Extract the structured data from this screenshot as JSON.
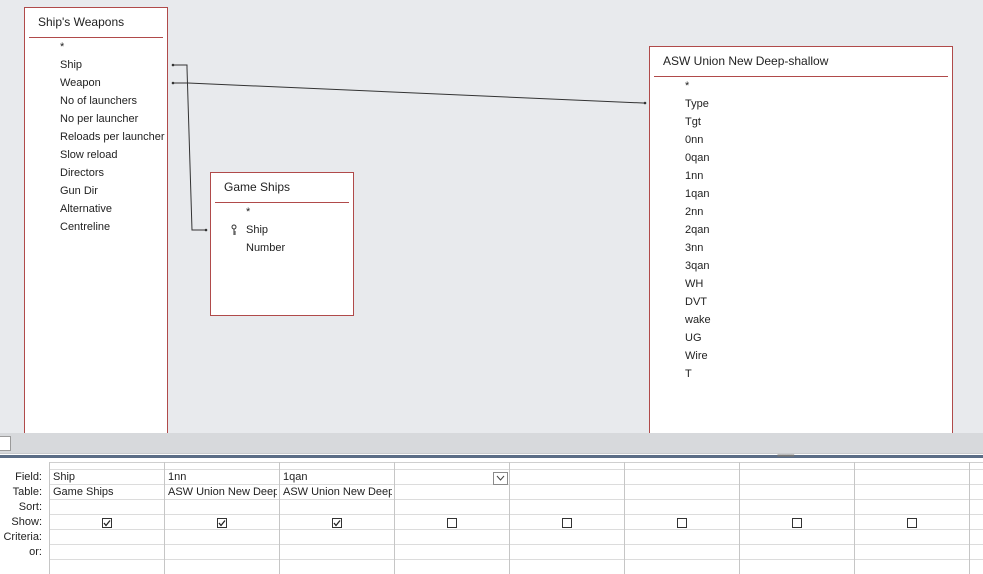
{
  "tables": {
    "ships_weapons": {
      "title": "Ship's Weapons",
      "fields": [
        "*",
        "Ship",
        "Weapon",
        "No of launchers",
        "No per launcher",
        "Reloads per launcher",
        "Slow reload",
        "Directors",
        "Gun Dir",
        "Alternative",
        "Centreline"
      ]
    },
    "game_ships": {
      "title": "Game Ships",
      "fields": [
        "*",
        "Ship",
        "Number"
      ],
      "key_field_icon": "key-icon"
    },
    "asw_union": {
      "title": "ASW Union New Deep-shallow",
      "fields": [
        "*",
        "Type",
        "Tgt",
        "0nn",
        "0qan",
        "1nn",
        "1qan",
        "2nn",
        "2qan",
        "3nn",
        "3qan",
        "WH",
        "DVT",
        "wake",
        "UG",
        "Wire",
        "T"
      ]
    }
  },
  "grid": {
    "row_labels": {
      "field": "Field:",
      "table": "Table:",
      "sort": "Sort:",
      "show": "Show:",
      "criteria": "Criteria:",
      "or": "or:"
    },
    "columns": [
      {
        "field": "Ship",
        "table": "Game Ships",
        "show": true
      },
      {
        "field": "1nn",
        "table": "ASW Union New Deep-shallow",
        "show": true
      },
      {
        "field": "1qan",
        "table": "ASW Union New Deep-shallow",
        "show": true
      },
      {
        "field": "",
        "table": "",
        "show": false
      },
      {
        "field": "",
        "table": "",
        "show": false
      },
      {
        "field": "",
        "table": "",
        "show": false
      },
      {
        "field": "",
        "table": "",
        "show": false
      },
      {
        "field": "",
        "table": "",
        "show": false
      }
    ]
  },
  "colors": {
    "table_border": "#b04a4a",
    "canvas": "#e8eaed",
    "grid_separator": "#5b6d86"
  }
}
